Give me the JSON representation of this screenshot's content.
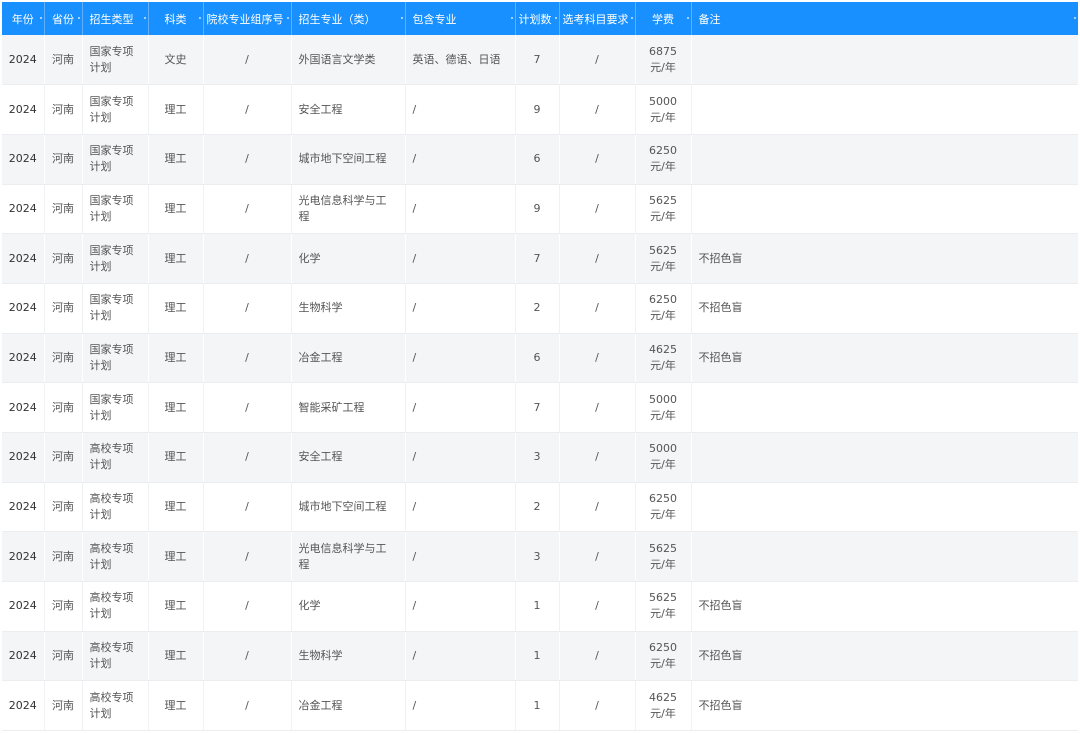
{
  "table": {
    "headers": [
      "年份",
      "省份",
      "招生类型",
      "科类",
      "院校专业组序号",
      "招生专业（类）",
      "包含专业",
      "计划数",
      "选考科目要求",
      "学费",
      "备注"
    ],
    "rows": [
      {
        "year": "2024",
        "province": "河南",
        "type": "国家专项计划",
        "category": "文史",
        "group": "/",
        "major": "外国语言文学类",
        "includes": "英语、德语、日语",
        "plan": "7",
        "subjects": "/",
        "fee": "6875元/年",
        "remark": ""
      },
      {
        "year": "2024",
        "province": "河南",
        "type": "国家专项计划",
        "category": "理工",
        "group": "/",
        "major": "安全工程",
        "includes": "/",
        "plan": "9",
        "subjects": "/",
        "fee": "5000元/年",
        "remark": ""
      },
      {
        "year": "2024",
        "province": "河南",
        "type": "国家专项计划",
        "category": "理工",
        "group": "/",
        "major": "城市地下空间工程",
        "includes": "/",
        "plan": "6",
        "subjects": "/",
        "fee": "6250元/年",
        "remark": ""
      },
      {
        "year": "2024",
        "province": "河南",
        "type": "国家专项计划",
        "category": "理工",
        "group": "/",
        "major": "光电信息科学与工程",
        "includes": "/",
        "plan": "9",
        "subjects": "/",
        "fee": "5625元/年",
        "remark": ""
      },
      {
        "year": "2024",
        "province": "河南",
        "type": "国家专项计划",
        "category": "理工",
        "group": "/",
        "major": "化学",
        "includes": "/",
        "plan": "7",
        "subjects": "/",
        "fee": "5625元/年",
        "remark": "不招色盲"
      },
      {
        "year": "2024",
        "province": "河南",
        "type": "国家专项计划",
        "category": "理工",
        "group": "/",
        "major": "生物科学",
        "includes": "/",
        "plan": "2",
        "subjects": "/",
        "fee": "6250元/年",
        "remark": "不招色盲"
      },
      {
        "year": "2024",
        "province": "河南",
        "type": "国家专项计划",
        "category": "理工",
        "group": "/",
        "major": "冶金工程",
        "includes": "/",
        "plan": "6",
        "subjects": "/",
        "fee": "4625元/年",
        "remark": "不招色盲"
      },
      {
        "year": "2024",
        "province": "河南",
        "type": "国家专项计划",
        "category": "理工",
        "group": "/",
        "major": "智能采矿工程",
        "includes": "/",
        "plan": "7",
        "subjects": "/",
        "fee": "5000元/年",
        "remark": ""
      },
      {
        "year": "2024",
        "province": "河南",
        "type": "高校专项计划",
        "category": "理工",
        "group": "/",
        "major": "安全工程",
        "includes": "/",
        "plan": "3",
        "subjects": "/",
        "fee": "5000元/年",
        "remark": ""
      },
      {
        "year": "2024",
        "province": "河南",
        "type": "高校专项计划",
        "category": "理工",
        "group": "/",
        "major": "城市地下空间工程",
        "includes": "/",
        "plan": "2",
        "subjects": "/",
        "fee": "6250元/年",
        "remark": ""
      },
      {
        "year": "2024",
        "province": "河南",
        "type": "高校专项计划",
        "category": "理工",
        "group": "/",
        "major": "光电信息科学与工程",
        "includes": "/",
        "plan": "3",
        "subjects": "/",
        "fee": "5625元/年",
        "remark": ""
      },
      {
        "year": "2024",
        "province": "河南",
        "type": "高校专项计划",
        "category": "理工",
        "group": "/",
        "major": "化学",
        "includes": "/",
        "plan": "1",
        "subjects": "/",
        "fee": "5625元/年",
        "remark": "不招色盲"
      },
      {
        "year": "2024",
        "province": "河南",
        "type": "高校专项计划",
        "category": "理工",
        "group": "/",
        "major": "生物科学",
        "includes": "/",
        "plan": "1",
        "subjects": "/",
        "fee": "6250元/年",
        "remark": "不招色盲"
      },
      {
        "year": "2024",
        "province": "河南",
        "type": "高校专项计划",
        "category": "理工",
        "group": "/",
        "major": "冶金工程",
        "includes": "/",
        "plan": "1",
        "subjects": "/",
        "fee": "4625元/年",
        "remark": "不招色盲"
      }
    ]
  },
  "colors": {
    "header_bg": "#1890ff",
    "header_text": "#ffffff",
    "row_stripe": "#f4f5f6",
    "cell_text": "#555555"
  }
}
